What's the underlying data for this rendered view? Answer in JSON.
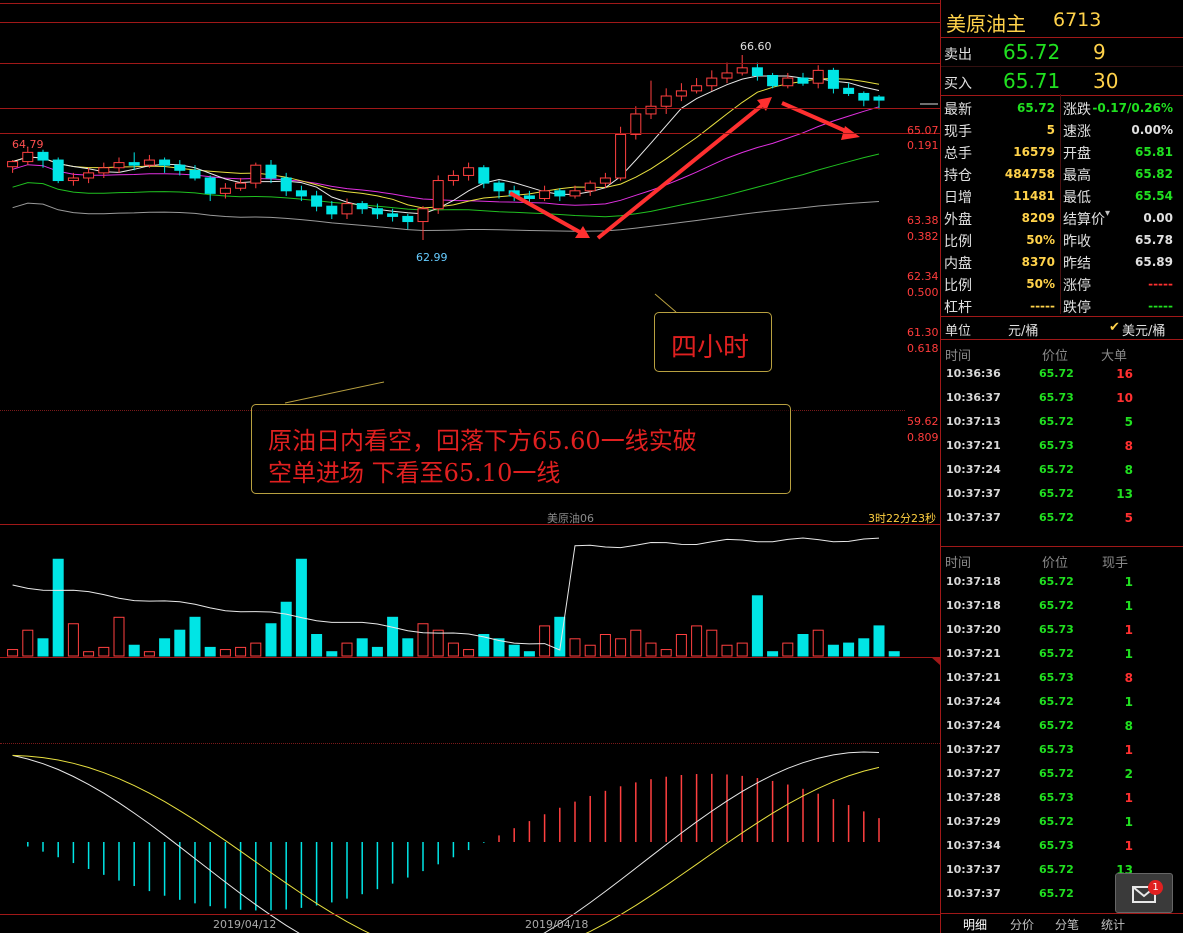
{
  "instrument": {
    "name": "美原油主",
    "code": "6713"
  },
  "sell": {
    "label": "卖出",
    "price": "65.72",
    "volume": "9"
  },
  "buy": {
    "label": "买入",
    "price": "65.71",
    "volume": "30"
  },
  "quote_left": [
    {
      "label": "最新",
      "value": "65.72",
      "color": "#20e020"
    },
    {
      "label": "现手",
      "value": "5",
      "color": "#ffd24a"
    },
    {
      "label": "总手",
      "value": "16579",
      "color": "#ffd24a"
    },
    {
      "label": "持仓",
      "value": "484758",
      "color": "#ffd24a"
    },
    {
      "label": "日增",
      "value": "11481",
      "color": "#ffd24a"
    },
    {
      "label": "外盘",
      "value": "8209",
      "color": "#ffd24a"
    },
    {
      "label": "比例",
      "value": "50%",
      "color": "#ffd24a"
    },
    {
      "label": "内盘",
      "value": "8370",
      "color": "#ffd24a"
    },
    {
      "label": "比例",
      "value": "50%",
      "color": "#ffd24a"
    },
    {
      "label": "杠杆",
      "value": "-----",
      "color": "#ffd24a"
    }
  ],
  "quote_right": [
    {
      "label": "涨跌",
      "value": "-0.17/0.26%",
      "color": "#20e020"
    },
    {
      "label": "速涨",
      "value": "0.00%",
      "color": "#e0e0e0"
    },
    {
      "label": "开盘",
      "value": "65.81",
      "color": "#20e020"
    },
    {
      "label": "最高",
      "value": "65.82",
      "color": "#20e020"
    },
    {
      "label": "最低",
      "value": "65.54",
      "color": "#20e020"
    },
    {
      "label": "结算价",
      "value": "0.00",
      "color": "#e0e0e0"
    },
    {
      "label": "昨收",
      "value": "65.78",
      "color": "#e0e0e0"
    },
    {
      "label": "昨结",
      "value": "65.89",
      "color": "#e0e0e0"
    },
    {
      "label": "涨停",
      "value": "-----",
      "color": "#ff3030"
    },
    {
      "label": "跌停",
      "value": "-----",
      "color": "#20e020"
    }
  ],
  "unit": {
    "label": "单位",
    "option1": "元/桶",
    "option2": "美元/桶"
  },
  "big_trades": {
    "headers": [
      "时间",
      "价位",
      "大单"
    ],
    "rows": [
      {
        "time": "10:36:36",
        "price": "65.72",
        "qty": "16",
        "color": "#ff3030"
      },
      {
        "time": "10:36:37",
        "price": "65.73",
        "qty": "10",
        "color": "#ff3030"
      },
      {
        "time": "10:37:13",
        "price": "65.72",
        "qty": "5",
        "color": "#20e020"
      },
      {
        "time": "10:37:21",
        "price": "65.73",
        "qty": "8",
        "color": "#ff3030"
      },
      {
        "time": "10:37:24",
        "price": "65.72",
        "qty": "8",
        "color": "#20e020"
      },
      {
        "time": "10:37:37",
        "price": "65.72",
        "qty": "13",
        "color": "#20e020"
      },
      {
        "time": "10:37:37",
        "price": "65.72",
        "qty": "5",
        "color": "#ff3030"
      }
    ]
  },
  "ticks": {
    "headers": [
      "时间",
      "价位",
      "现手"
    ],
    "rows": [
      {
        "time": "10:37:18",
        "price": "65.72",
        "qty": "1",
        "color": "#20e020"
      },
      {
        "time": "10:37:18",
        "price": "65.72",
        "qty": "1",
        "color": "#20e020"
      },
      {
        "time": "10:37:20",
        "price": "65.73",
        "qty": "1",
        "color": "#ff3030"
      },
      {
        "time": "10:37:21",
        "price": "65.72",
        "qty": "1",
        "color": "#20e020"
      },
      {
        "time": "10:37:21",
        "price": "65.73",
        "qty": "8",
        "color": "#ff3030"
      },
      {
        "time": "10:37:24",
        "price": "65.72",
        "qty": "1",
        "color": "#20e020"
      },
      {
        "time": "10:37:24",
        "price": "65.72",
        "qty": "8",
        "color": "#20e020"
      },
      {
        "time": "10:37:27",
        "price": "65.73",
        "qty": "1",
        "color": "#ff3030"
      },
      {
        "time": "10:37:27",
        "price": "65.72",
        "qty": "2",
        "color": "#20e020"
      },
      {
        "time": "10:37:28",
        "price": "65.73",
        "qty": "1",
        "color": "#ff3030"
      },
      {
        "time": "10:37:29",
        "price": "65.72",
        "qty": "1",
        "color": "#20e020"
      },
      {
        "time": "10:37:34",
        "price": "65.73",
        "qty": "1",
        "color": "#ff3030"
      },
      {
        "time": "10:37:37",
        "price": "65.72",
        "qty": "13",
        "color": "#20e020"
      },
      {
        "time": "10:37:37",
        "price": "65.72",
        "qty": "",
        "color": "#ff3030"
      }
    ]
  },
  "tabs": [
    "明细",
    "分价",
    "分笔",
    "统计"
  ],
  "mail_badge": "1",
  "chart": {
    "high_label": "66.60",
    "low_label": "62.99",
    "left_label": "64.79",
    "pane_title": "美原油06",
    "countdown": "3时22分23秒",
    "period_label": "四小时",
    "annotation_line1": "原油日内看空，回落下方65.60一线实破",
    "annotation_line2": "空单进场 下看至65.10一线",
    "levels": [
      {
        "price": "65.07",
        "ratio": "0.191"
      },
      {
        "price": "63.38",
        "ratio": "0.382"
      },
      {
        "price": "62.34",
        "ratio": "0.500"
      },
      {
        "price": "61.30",
        "ratio": "0.618"
      },
      {
        "price": "59.62",
        "ratio": "0.809"
      }
    ],
    "dates": [
      "2019/04/12",
      "2019/04/18"
    ],
    "colors": {
      "up": "#ff4040",
      "down": "#00e5e5",
      "arrow": "#ff3030"
    }
  },
  "chart_data": {
    "type": "candlestick",
    "candles": [
      [
        64.42,
        64.52,
        64.55,
        64.3
      ],
      [
        64.52,
        64.7,
        64.79,
        64.45
      ],
      [
        64.7,
        64.55,
        64.75,
        64.4
      ],
      [
        64.55,
        64.15,
        64.6,
        64.1
      ],
      [
        64.15,
        64.2,
        64.3,
        64.05
      ],
      [
        64.2,
        64.3,
        64.4,
        64.1
      ],
      [
        64.3,
        64.4,
        64.5,
        64.2
      ],
      [
        64.4,
        64.5,
        64.6,
        64.3
      ],
      [
        64.5,
        64.45,
        64.7,
        64.35
      ],
      [
        64.45,
        64.55,
        64.65,
        64.4
      ],
      [
        64.55,
        64.45,
        64.6,
        64.3
      ],
      [
        64.45,
        64.35,
        64.55,
        64.25
      ],
      [
        64.35,
        64.2,
        64.45,
        64.15
      ],
      [
        64.2,
        63.9,
        64.25,
        63.75
      ],
      [
        63.9,
        64.0,
        64.1,
        63.8
      ],
      [
        64.0,
        64.1,
        64.2,
        63.95
      ],
      [
        64.1,
        64.45,
        64.5,
        64.0
      ],
      [
        64.45,
        64.2,
        64.55,
        64.1
      ],
      [
        64.2,
        63.95,
        64.3,
        63.85
      ],
      [
        63.95,
        63.85,
        64.05,
        63.75
      ],
      [
        63.85,
        63.65,
        63.95,
        63.55
      ],
      [
        63.65,
        63.5,
        63.75,
        63.4
      ],
      [
        63.5,
        63.7,
        63.8,
        63.4
      ],
      [
        63.7,
        63.6,
        63.75,
        63.5
      ],
      [
        63.6,
        63.5,
        63.7,
        63.4
      ],
      [
        63.5,
        63.45,
        63.6,
        63.35
      ],
      [
        63.45,
        63.35,
        63.5,
        63.2
      ],
      [
        63.35,
        63.6,
        63.65,
        62.99
      ],
      [
        63.6,
        64.15,
        64.25,
        63.5
      ],
      [
        64.15,
        64.25,
        64.35,
        64.05
      ],
      [
        64.25,
        64.4,
        64.5,
        64.15
      ],
      [
        64.4,
        64.1,
        64.45,
        64.0
      ],
      [
        64.1,
        63.95,
        64.15,
        63.8
      ],
      [
        63.95,
        63.85,
        64.05,
        63.75
      ],
      [
        63.85,
        63.8,
        63.95,
        63.7
      ],
      [
        63.8,
        63.95,
        64.05,
        63.75
      ],
      [
        63.95,
        63.85,
        64.0,
        63.75
      ],
      [
        63.85,
        63.95,
        64.05,
        63.8
      ],
      [
        63.95,
        64.1,
        64.15,
        63.85
      ],
      [
        64.1,
        64.2,
        64.3,
        64.0
      ],
      [
        64.2,
        65.05,
        65.2,
        64.15
      ],
      [
        65.05,
        65.45,
        65.6,
        64.95
      ],
      [
        65.45,
        65.6,
        66.1,
        65.35
      ],
      [
        65.6,
        65.8,
        65.95,
        65.45
      ],
      [
        65.8,
        65.9,
        66.05,
        65.7
      ],
      [
        65.9,
        66.0,
        66.15,
        65.85
      ],
      [
        66.0,
        66.15,
        66.3,
        65.9
      ],
      [
        66.15,
        66.25,
        66.45,
        66.05
      ],
      [
        66.25,
        66.35,
        66.6,
        66.2
      ],
      [
        66.35,
        66.2,
        66.45,
        66.1
      ],
      [
        66.2,
        66.0,
        66.25,
        65.95
      ],
      [
        66.0,
        66.15,
        66.25,
        65.95
      ],
      [
        66.15,
        66.05,
        66.25,
        66.0
      ],
      [
        66.05,
        66.3,
        66.4,
        65.95
      ],
      [
        66.3,
        65.95,
        66.35,
        65.85
      ],
      [
        65.95,
        65.85,
        66.05,
        65.8
      ],
      [
        65.85,
        65.72,
        65.89,
        65.6
      ],
      [
        65.78,
        65.72,
        65.82,
        65.54
      ]
    ],
    "volume": [
      3,
      12,
      8,
      45,
      15,
      2,
      4,
      18,
      5,
      2,
      8,
      12,
      18,
      4,
      3,
      4,
      6,
      15,
      25,
      45,
      10,
      2,
      6,
      8,
      4,
      18,
      8,
      15,
      12,
      6,
      3,
      10,
      8,
      5,
      2,
      14,
      18,
      8,
      5,
      10,
      8,
      12,
      6,
      3,
      10,
      14,
      12,
      5,
      6,
      28,
      2,
      6,
      10,
      12,
      5,
      6,
      8,
      14,
      2
    ],
    "xlabels": [
      "2019/04/12",
      "2019/04/18"
    ]
  }
}
